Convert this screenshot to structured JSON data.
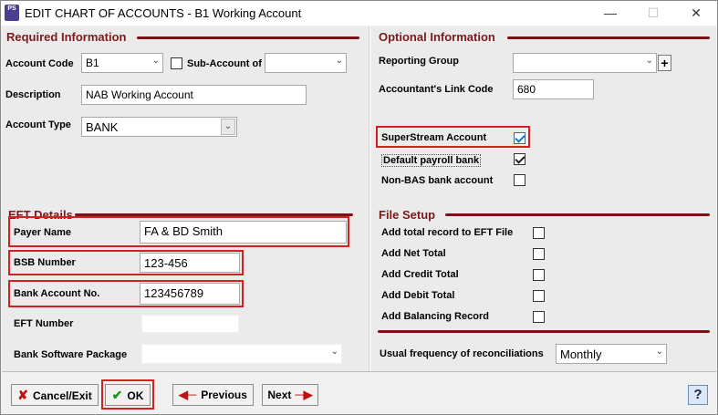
{
  "window": {
    "app_icon_text": "PS",
    "title": "EDIT CHART OF ACCOUNTS - B1 Working Account",
    "minimize": "—",
    "maximize": "☐",
    "close": "✕"
  },
  "required": {
    "title": "Required Information",
    "account_code_label": "Account Code",
    "account_code_value": "B1",
    "sub_account_label": "Sub-Account of",
    "sub_account_value": "",
    "description_label": "Description",
    "description_value": "NAB Working Account",
    "account_type_label": "Account Type",
    "account_type_value": "BANK"
  },
  "eft": {
    "title": "EFT Details",
    "payer_name_label": "Payer Name",
    "payer_name_value": "FA & BD Smith",
    "bsb_label": "BSB Number",
    "bsb_value": "123-456",
    "bank_account_label": "Bank Account No.",
    "bank_account_value": "123456789",
    "eft_number_label": "EFT Number",
    "eft_number_value": "",
    "software_label": "Bank Software Package",
    "software_value": ""
  },
  "optional": {
    "title": "Optional Information",
    "reporting_group_label": "Reporting Group",
    "reporting_group_value": "",
    "link_code_label": "Accountant's Link Code",
    "link_code_value": "680",
    "superstream_label": "SuperStream Account",
    "superstream_checked": true,
    "default_payroll_label": "Default payroll bank",
    "default_payroll_checked": true,
    "non_bas_label": "Non-BAS bank account",
    "non_bas_checked": false
  },
  "file_setup": {
    "title": "File Setup",
    "items": [
      {
        "label": "Add total record to EFT File",
        "checked": false
      },
      {
        "label": "Add Net Total",
        "checked": false
      },
      {
        "label": "Add Credit Total",
        "checked": false
      },
      {
        "label": "Add Debit Total",
        "checked": false
      },
      {
        "label": "Add Balancing Record",
        "checked": false
      }
    ],
    "frequency_label": "Usual frequency of reconciliations",
    "frequency_value": "Monthly"
  },
  "footer": {
    "cancel_label": "Cancel/Exit",
    "ok_label": "OK",
    "previous_label": "Previous",
    "next_label": "Next",
    "help_label": "?"
  },
  "colors": {
    "accent_dark_red": "#7a1414",
    "highlight_red": "#d32020",
    "check_blue": "#1a73c8"
  }
}
